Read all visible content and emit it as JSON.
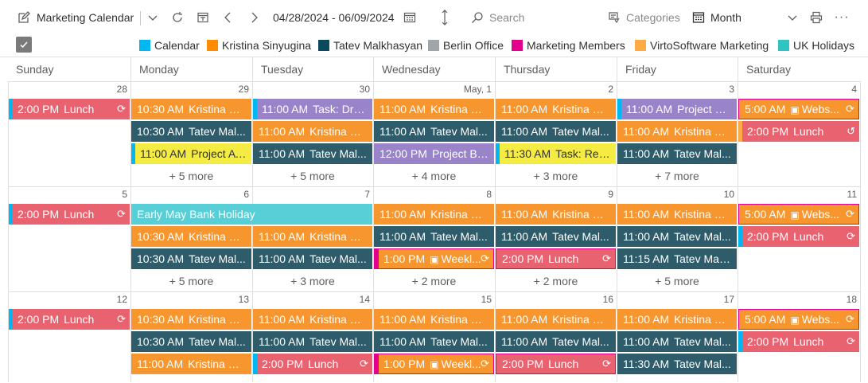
{
  "toolbar": {
    "title": "Marketing Calendar",
    "date_range": "04/28/2024 - 06/09/2024",
    "search_placeholder": "Search",
    "categories_label": "Categories",
    "view_label": "Month",
    "more_label": "···"
  },
  "legend": [
    {
      "label": "Calendar",
      "color": "#00b7f1"
    },
    {
      "label": "Kristina Sinyugina",
      "color": "#ff8c00"
    },
    {
      "label": "Tatev Malkhasyan",
      "color": "#0b4a5c"
    },
    {
      "label": "Berlin Office",
      "color": "#a0a5a8"
    },
    {
      "label": "Marketing Members",
      "color": "#e3008c"
    },
    {
      "label": "VirtoSoftware Marketing",
      "color": "#ffaa44"
    },
    {
      "label": "UK Holidays",
      "color": "#2ec4c4"
    }
  ],
  "weekdays": [
    "Sunday",
    "Monday",
    "Tuesday",
    "Wednesday",
    "Thursday",
    "Friday",
    "Saturday"
  ],
  "weeks": [
    {
      "days": [
        "28",
        "29",
        "30",
        "May, 1",
        "2",
        "3",
        "4"
      ],
      "events": [
        {
          "col": 0,
          "row": 0,
          "span": 1,
          "time": "2:00 PM",
          "title": "Lunch",
          "style": "red",
          "recur": true,
          "bar": "#00b7f1"
        },
        {
          "col": 1,
          "row": 0,
          "span": 1,
          "time": "10:30 AM",
          "title": "Kristina Si...",
          "style": "orange"
        },
        {
          "col": 1,
          "row": 1,
          "span": 1,
          "time": "10:30 AM",
          "title": "Tatev Mal...",
          "style": "teal"
        },
        {
          "col": 1,
          "row": 2,
          "span": 1,
          "time": "11:00 AM",
          "title": "Project A ...",
          "style": "yellow",
          "bar": "#00b7f1"
        },
        {
          "col": 2,
          "row": 0,
          "span": 1,
          "time": "11:00 AM",
          "title": "Task: Draf...",
          "style": "purple",
          "bar": "#00b7f1"
        },
        {
          "col": 2,
          "row": 1,
          "span": 1,
          "time": "11:00 AM",
          "title": "Kristina Si...",
          "style": "orange"
        },
        {
          "col": 2,
          "row": 2,
          "span": 1,
          "time": "11:00 AM",
          "title": "Tatev Mal...",
          "style": "teal"
        },
        {
          "col": 3,
          "row": 0,
          "span": 1,
          "time": "11:00 AM",
          "title": "Kristina Si...",
          "style": "orange"
        },
        {
          "col": 3,
          "row": 1,
          "span": 1,
          "time": "11:00 AM",
          "title": "Tatev Mal...",
          "style": "teal"
        },
        {
          "col": 3,
          "row": 2,
          "span": 1,
          "time": "12:00 PM",
          "title": "Project B ...",
          "style": "purple"
        },
        {
          "col": 4,
          "row": 0,
          "span": 1,
          "time": "11:00 AM",
          "title": "Kristina Si...",
          "style": "orange"
        },
        {
          "col": 4,
          "row": 1,
          "span": 1,
          "time": "11:00 AM",
          "title": "Tatev Mal...",
          "style": "teal"
        },
        {
          "col": 4,
          "row": 2,
          "span": 1,
          "time": "11:30 AM",
          "title": "Task: Revi...",
          "style": "yellow",
          "bar": "#00b7f1"
        },
        {
          "col": 5,
          "row": 0,
          "span": 1,
          "time": "11:00 AM",
          "title": "Project B ...",
          "style": "purple",
          "bar": "#00b7f1"
        },
        {
          "col": 5,
          "row": 1,
          "span": 1,
          "time": "11:00 AM",
          "title": "Kristina Si...",
          "style": "orange"
        },
        {
          "col": 5,
          "row": 2,
          "span": 1,
          "time": "11:00 AM",
          "title": "Tatev Mal...",
          "style": "teal"
        },
        {
          "col": 6,
          "row": 0,
          "span": 1,
          "time": "5:00 AM",
          "title": "Webs...",
          "style": "orange",
          "teams": true,
          "recur": true,
          "border": "#e3008c"
        },
        {
          "col": 6,
          "row": 1,
          "span": 1,
          "time": "2:00 PM",
          "title": "Lunch",
          "style": "red",
          "recur": true,
          "recurx": true,
          "bar": "#ffaa44"
        }
      ],
      "more": [
        "",
        "+ 5 more",
        "+ 5 more",
        "+ 4 more",
        "+ 3 more",
        "+ 7 more",
        ""
      ]
    },
    {
      "days": [
        "5",
        "6",
        "7",
        "8",
        "9",
        "10",
        "11"
      ],
      "events": [
        {
          "col": 0,
          "row": 0,
          "span": 1,
          "time": "2:00 PM",
          "title": "Lunch",
          "style": "red",
          "recur": true,
          "bar": "#00b7f1"
        },
        {
          "col": 1,
          "row": 0,
          "span": 2,
          "time": "",
          "title": "Early May Bank Holiday",
          "style": "cyan"
        },
        {
          "col": 3,
          "row": 0,
          "span": 1,
          "time": "11:00 AM",
          "title": "Kristina Si...",
          "style": "orange"
        },
        {
          "col": 4,
          "row": 0,
          "span": 1,
          "time": "11:00 AM",
          "title": "Kristina Si...",
          "style": "orange"
        },
        {
          "col": 5,
          "row": 0,
          "span": 1,
          "time": "11:00 AM",
          "title": "Kristina Si...",
          "style": "orange"
        },
        {
          "col": 6,
          "row": 0,
          "span": 1,
          "time": "5:00 AM",
          "title": "Webs...",
          "style": "orange",
          "teams": true,
          "recur": true,
          "border": "#e3008c"
        },
        {
          "col": 1,
          "row": 1,
          "span": 1,
          "time": "10:30 AM",
          "title": "Kristina Si...",
          "style": "orange"
        },
        {
          "col": 2,
          "row": 1,
          "span": 1,
          "time": "11:00 AM",
          "title": "Kristina Si...",
          "style": "orange"
        },
        {
          "col": 3,
          "row": 1,
          "span": 1,
          "time": "11:00 AM",
          "title": "Tatev Mal...",
          "style": "teal"
        },
        {
          "col": 4,
          "row": 1,
          "span": 1,
          "time": "11:00 AM",
          "title": "Tatev Mal...",
          "style": "teal"
        },
        {
          "col": 5,
          "row": 1,
          "span": 1,
          "time": "11:00 AM",
          "title": "Tatev Mal...",
          "style": "teal"
        },
        {
          "col": 6,
          "row": 1,
          "span": 1,
          "time": "2:00 PM",
          "title": "Lunch",
          "style": "red",
          "recur": true,
          "bar": "#00b7f1"
        },
        {
          "col": 1,
          "row": 2,
          "span": 1,
          "time": "10:30 AM",
          "title": "Tatev Mal...",
          "style": "teal"
        },
        {
          "col": 2,
          "row": 2,
          "span": 1,
          "time": "11:00 AM",
          "title": "Tatev Mal...",
          "style": "teal"
        },
        {
          "col": 3,
          "row": 2,
          "span": 1,
          "time": "1:00 PM",
          "title": "Weekl...",
          "style": "orange",
          "teams": true,
          "recur": true,
          "bar": "#e3008c",
          "border": "#e3008c"
        },
        {
          "col": 4,
          "row": 2,
          "span": 1,
          "time": "2:00 PM",
          "title": "Lunch",
          "style": "red",
          "recur": true,
          "border": "#e3008c"
        },
        {
          "col": 5,
          "row": 2,
          "span": 1,
          "time": "11:15 AM",
          "title": "Tatev Malk...",
          "style": "teal"
        }
      ],
      "more": [
        "",
        "+ 5 more",
        "+ 3 more",
        "+ 2 more",
        "+ 2 more",
        "+ 5 more",
        ""
      ]
    },
    {
      "days": [
        "12",
        "13",
        "14",
        "15",
        "16",
        "17",
        "18"
      ],
      "events": [
        {
          "col": 0,
          "row": 0,
          "span": 1,
          "time": "2:00 PM",
          "title": "Lunch",
          "style": "red",
          "recur": true,
          "bar": "#00b7f1"
        },
        {
          "col": 1,
          "row": 0,
          "span": 1,
          "time": "10:30 AM",
          "title": "Kristina Si...",
          "style": "orange"
        },
        {
          "col": 2,
          "row": 0,
          "span": 1,
          "time": "11:00 AM",
          "title": "Kristina Si...",
          "style": "orange"
        },
        {
          "col": 3,
          "row": 0,
          "span": 1,
          "time": "11:00 AM",
          "title": "Kristina Si...",
          "style": "orange"
        },
        {
          "col": 4,
          "row": 0,
          "span": 1,
          "time": "11:00 AM",
          "title": "Kristina Si...",
          "style": "orange"
        },
        {
          "col": 5,
          "row": 0,
          "span": 1,
          "time": "11:00 AM",
          "title": "Kristina Si...",
          "style": "orange"
        },
        {
          "col": 6,
          "row": 0,
          "span": 1,
          "time": "5:00 AM",
          "title": "Webs...",
          "style": "orange",
          "teams": true,
          "recur": true,
          "border": "#e3008c"
        },
        {
          "col": 1,
          "row": 1,
          "span": 1,
          "time": "10:30 AM",
          "title": "Tatev Mal...",
          "style": "teal"
        },
        {
          "col": 2,
          "row": 1,
          "span": 1,
          "time": "11:00 AM",
          "title": "Tatev Mal...",
          "style": "teal"
        },
        {
          "col": 3,
          "row": 1,
          "span": 1,
          "time": "11:00 AM",
          "title": "Tatev Mal...",
          "style": "teal"
        },
        {
          "col": 4,
          "row": 1,
          "span": 1,
          "time": "11:00 AM",
          "title": "Tatev Mal...",
          "style": "teal"
        },
        {
          "col": 5,
          "row": 1,
          "span": 1,
          "time": "11:00 AM",
          "title": "Tatev Mal...",
          "style": "teal"
        },
        {
          "col": 6,
          "row": 1,
          "span": 1,
          "time": "2:00 PM",
          "title": "Lunch",
          "style": "red",
          "recur": true,
          "bar": "#00b7f1"
        },
        {
          "col": 1,
          "row": 2,
          "span": 1,
          "time": "11:00 AM",
          "title": "Kristina Si...",
          "style": "orange"
        },
        {
          "col": 2,
          "row": 2,
          "span": 1,
          "time": "2:00 PM",
          "title": "Lunch",
          "style": "red",
          "recur": true,
          "bar": "#00b7f1"
        },
        {
          "col": 3,
          "row": 2,
          "span": 1,
          "time": "1:00 PM",
          "title": "Weekl...",
          "style": "orange",
          "teams": true,
          "recur": true,
          "bar": "#e3008c",
          "border": "#e3008c"
        },
        {
          "col": 4,
          "row": 2,
          "span": 1,
          "time": "2:00 PM",
          "title": "Lunch",
          "style": "red",
          "recur": true,
          "border": "#e3008c"
        },
        {
          "col": 5,
          "row": 2,
          "span": 1,
          "time": "11:30 AM",
          "title": "Tatev Mal...",
          "style": "teal"
        }
      ],
      "more": [
        "",
        "",
        "",
        "",
        "",
        "",
        ""
      ]
    }
  ],
  "styles": {
    "orange": {
      "bg": "#f7962f",
      "fg": "#ffffff"
    },
    "teal": {
      "bg": "#2f5c6a",
      "fg": "#ffffff"
    },
    "red": {
      "bg": "#e8636f",
      "fg": "#ffffff"
    },
    "purple": {
      "bg": "#9a84c9",
      "fg": "#ffffff"
    },
    "yellow": {
      "bg": "#f4ec43",
      "fg": "#323130"
    },
    "cyan": {
      "bg": "#58cfd6",
      "fg": "#ffffff"
    }
  },
  "icons": {
    "recur": "⟳",
    "recur_x": "↺",
    "teams": "▣"
  }
}
